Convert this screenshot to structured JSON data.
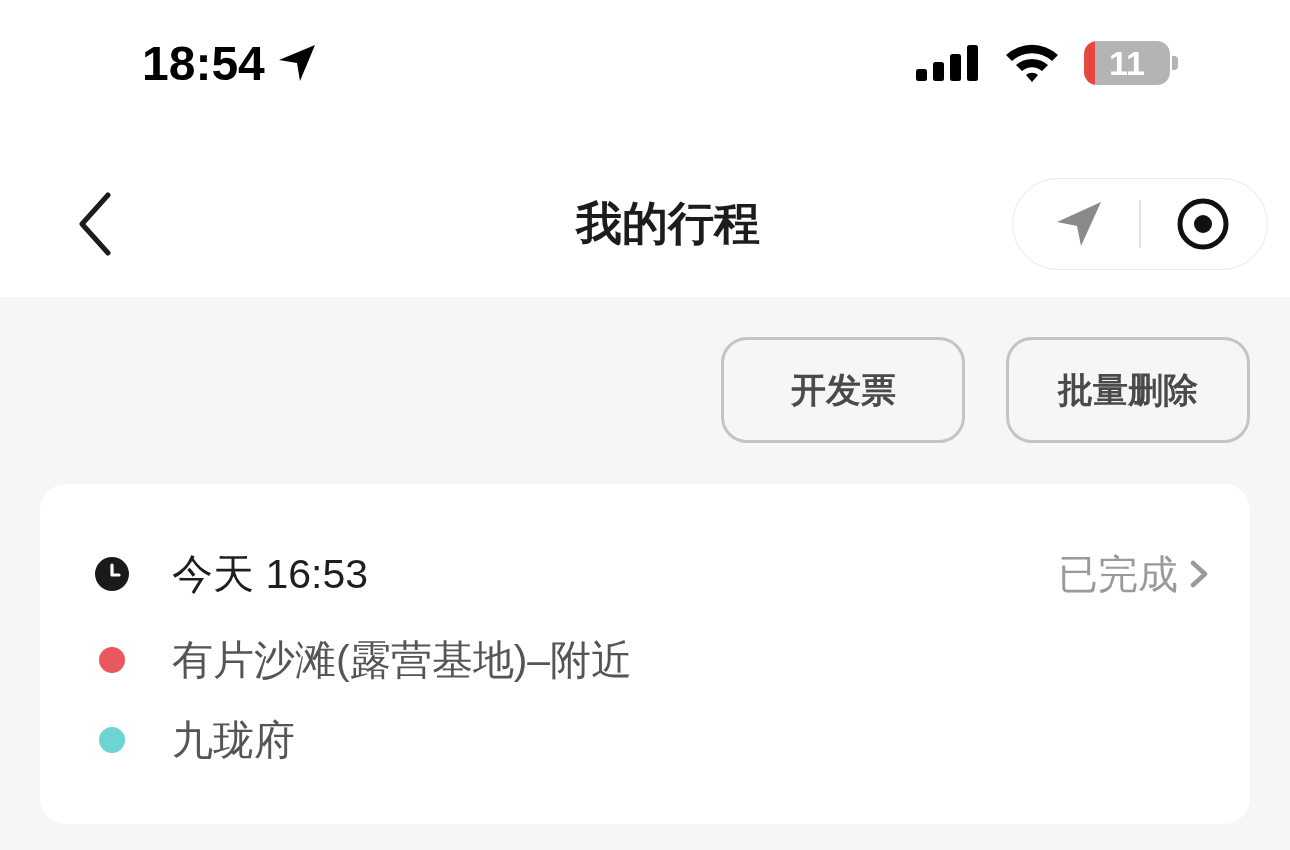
{
  "status_bar": {
    "time": "18:54",
    "battery": "11"
  },
  "nav": {
    "title": "我的行程"
  },
  "actions": [
    {
      "label": "开发票"
    },
    {
      "label": "批量删除"
    }
  ],
  "trips": [
    {
      "time": "今天 16:53",
      "status": "已完成",
      "stops": [
        {
          "name": "有片沙滩(露营基地)–附近",
          "color": "#e8585e"
        },
        {
          "name": "九珑府",
          "color": "#6dd3d3"
        }
      ]
    }
  ]
}
